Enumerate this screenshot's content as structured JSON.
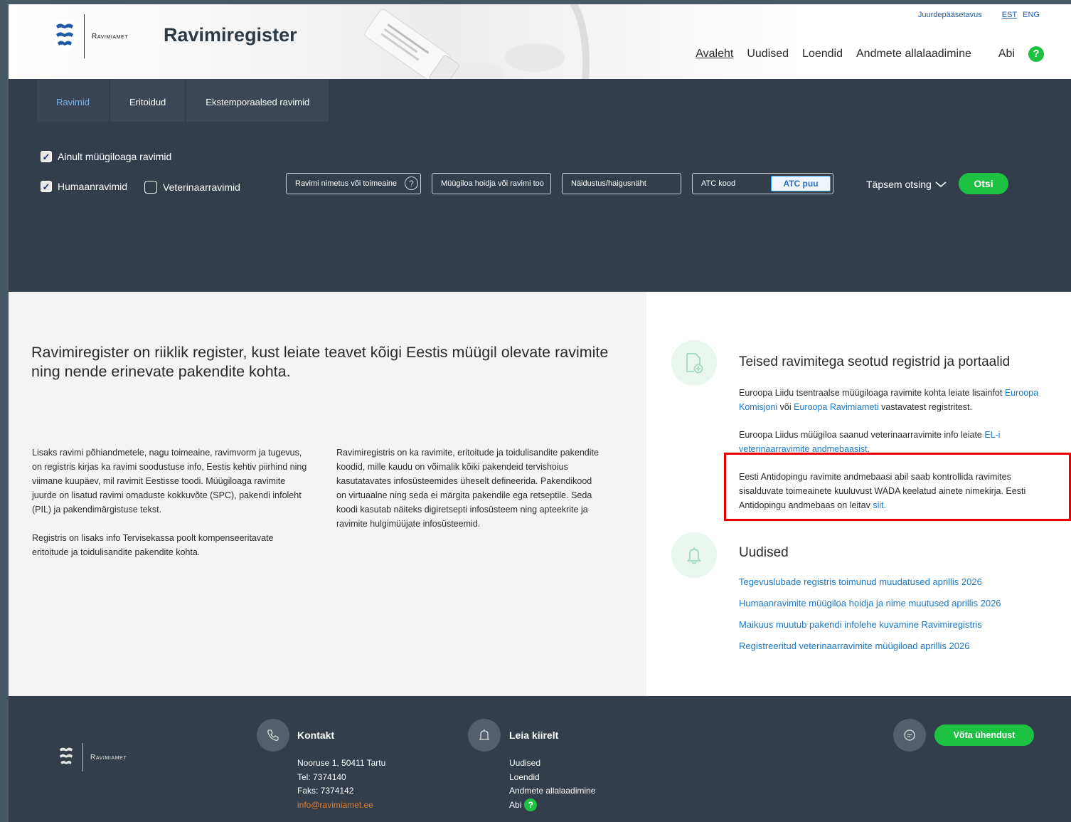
{
  "header": {
    "logo_text": "Ravimiamet",
    "site_title": "Ravimiregister",
    "util": {
      "accessibility": "Juurdepääsetavus",
      "lang_est": "EST",
      "lang_eng": "ENG"
    },
    "nav": [
      "Avaleh",
      "Uudised",
      "Loendid",
      "Andmete allalaadimine",
      "Abi"
    ],
    "nav_help_icon": "?"
  },
  "search": {
    "tabs": [
      "Ravimid",
      "Eritoidud",
      "Ekstemporaalsed ravimid"
    ],
    "checkbox_only_licensed": {
      "label": "Ainult müügiloaga ravimid",
      "checked": true
    },
    "checkbox_human": {
      "label": "Humaanravimid",
      "checked": true
    },
    "checkbox_vet": {
      "label": "Veterinaarravimid",
      "checked": false
    },
    "field_name_placeholder": "Ravimi nimetus või toimeaine",
    "field_name_help": "?",
    "field_holder_placeholder": "Müügiloa hoidja või ravimi tootja",
    "field_indication_placeholder": "Näidustus/haigusnäht",
    "field_atc_placeholder": "ATC kood",
    "atc_tree_button": "ATC puu",
    "advanced_search": "Täpsem otsing",
    "search_button": "Otsi"
  },
  "main": {
    "intro": "Ravimiregister on riiklik register, kust leiate teavet kõigi Eestis müügil olevate ravimite ning nende erinevate pakendite kohta.",
    "col1_p1": "Lisaks ravimi põhiandmetele, nagu toimeaine, ravimvorm ja tugevus, on registris kirjas ka ravimi soodustuse info, Eestis kehtiv piirhind ning viimane kuupäev, mil ravimit Eestisse toodi. Müügiloaga ravimite juurde on lisatud ravimi omaduste kokkuvõte (SPC), pakendi infoleht (PIL) ja pakendimärgistuse tekst.",
    "col1_p2": "Registris on lisaks info Tervisekassa poolt kompenseeritavate eritoitude ja toidulisandite pakendite kohta.",
    "col2_p1": "Ravimiregistris on ka ravimite, eritoitude ja toidulisandite pakendite koodid, mille kaudu on võimalik kõiki pakendeid tervishoius kasutatavates infosüsteemides üheselt defineerida. Pakendikood on virtuaalne ning seda ei märgita pakendile ega retseptile. Seda koodi kasutab näiteks digiretsepti infosüsteem ning apteekrite ja ravimite hulgimüüjate infosüsteemid."
  },
  "registers": {
    "title": "Teised ravimitega seotud registrid ja portaalid",
    "p1_pre": "Euroopa Liidu tsentraalse müügiloaga ravimite kohta leiate lisainfot ",
    "p1_link1": "Euroopa Komisjoni",
    "p1_mid": " või ",
    "p1_link2": "Euroopa Ravimiameti",
    "p1_post": " vastavatest registritest.",
    "p2_pre": "Euroopa Liidus müügiloa saanud veterinaarravimite info leiate ",
    "p2_link": "EL-i veterinaarravimite andmebaasist.",
    "p3_pre": "Eesti Antidopingu ravimite andmebaasi abil saab kontrollida ravimites sisalduvate toimeainete kuuluvust WADA keelatud ainete nimekirja. Eesti Antidopingu andmebaas on leitav ",
    "p3_link": "siit."
  },
  "news": {
    "title": "Uudised",
    "items": [
      "Tegevuslubade registris toimunud muudatused aprillis 2026",
      "Humaanravimite müügiloa hoidja ja nime muutused aprillis 2026",
      "Maikuus muutub pakendi infolehe kuvamine Ravimiregistris",
      "Registreeritud veterinaarravimite müügiload aprillis 2026"
    ]
  },
  "footer": {
    "logo_text": "Ravimiamet",
    "contact_title": "Kontakt",
    "contact_lines": [
      "Nooruse 1, 50411 Tartu",
      "Tel: 7374140",
      "Faks: 7374142"
    ],
    "contact_email": "info@ravimiamet.ee",
    "quick_title": "Leia kiirelt",
    "quick_links": [
      "Uudised",
      "Loendid",
      "Andmete allalaadimine",
      "Abi"
    ],
    "quick_help_icon": "?",
    "contact_button": "Võta ühendust"
  },
  "colors": {
    "accent_green": "#1ec243",
    "link_blue": "#1b78c6",
    "dark_panel": "#343d4c",
    "highlight_red": "#e60000"
  }
}
